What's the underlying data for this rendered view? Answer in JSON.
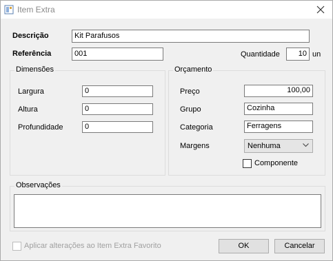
{
  "window": {
    "title": "Item Extra"
  },
  "form": {
    "descricao_label": "Descrição",
    "descricao_value": "Kit Parafusos",
    "referencia_label": "Referência",
    "referencia_value": "001",
    "quantidade_label": "Quantidade",
    "quantidade_value": "10",
    "quantidade_unit": "un"
  },
  "dimensoes": {
    "title": "Dimensões",
    "fields": [
      {
        "label": "Largura",
        "value": "0"
      },
      {
        "label": "Altura",
        "value": "0"
      },
      {
        "label": "Profundidade",
        "value": "0"
      }
    ]
  },
  "orcamento": {
    "title": "Orçamento",
    "preco_label": "Preço",
    "preco_value": "100,00",
    "grupo_label": "Grupo",
    "grupo_value": "Cozinha",
    "categoria_label": "Categoria",
    "categoria_value": "Ferragens",
    "margens_label": "Margens",
    "margens_value": "Nenhuma",
    "componente_label": "Componente"
  },
  "observacoes": {
    "title": "Observações",
    "value": ""
  },
  "footer": {
    "favorito_label": "Aplicar alterações ao Item Extra Favorito",
    "ok_label": "OK",
    "cancel_label": "Cancelar"
  }
}
